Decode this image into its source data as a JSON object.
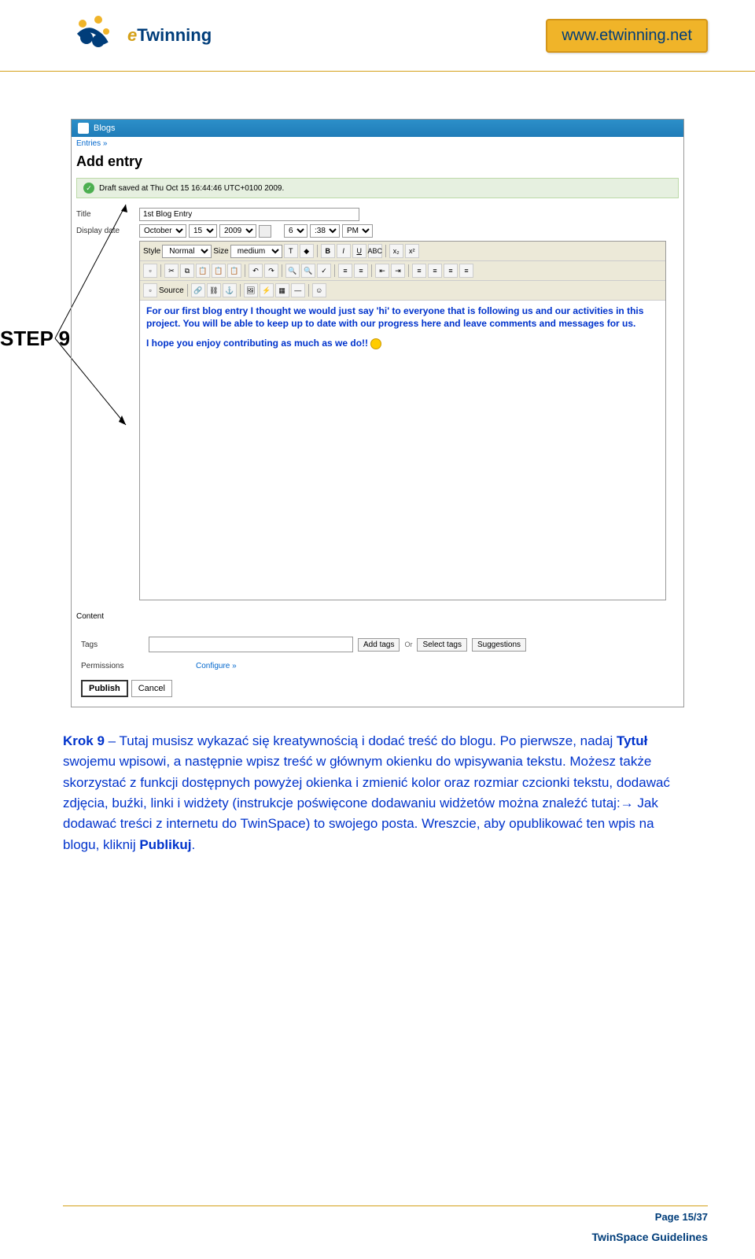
{
  "header": {
    "logo_text_e": "e",
    "logo_text_rest": "Twinning",
    "url": "www.etwinning.net"
  },
  "screenshot": {
    "blogs_label": "Blogs",
    "entries_link": "Entries »",
    "add_entry": "Add entry",
    "draft_saved": "Draft saved at Thu Oct 15 16:44:46 UTC+0100 2009.",
    "title_label": "Title",
    "title_value": "1st Blog Entry",
    "display_date_label": "Display date",
    "date": {
      "month": "October",
      "day": "15",
      "year": "2009",
      "hour": "6",
      "minute": ":38",
      "ampm": "PM"
    },
    "style_label": "Style",
    "style_value": "Normal",
    "size_label": "Size",
    "size_value": "medium",
    "source_label": "Source",
    "content_label": "Content",
    "editor_p1": "For our first blog entry I thought we would just say 'hi' to everyone that is following us and our activities in this project. You will be able to keep up to date with our progress here and leave comments and messages for us.",
    "editor_p2": "I hope you enjoy contributing as much as we do!!",
    "tags_label": "Tags",
    "add_tags": "Add tags",
    "or": "Or",
    "select_tags": "Select tags",
    "suggestions": "Suggestions",
    "permissions_label": "Permissions",
    "configure": "Configure »",
    "publish": "Publish",
    "cancel": "Cancel"
  },
  "step_label": "STEP 9",
  "body": {
    "p1_a": "Krok 9",
    "p1_b": " – Tutaj musisz wykazać się kreatywnością i dodać treść do blogu. Po pierwsze, nadaj ",
    "p1_c": "Tytuł",
    "p1_d": " swojemu wpisowi, a następnie wpisz treść w głównym okienku do wpisywania tekstu. Możesz także skorzystać z funkcji dostępnych powyżej okienka i zmienić kolor oraz rozmiar czcionki tekstu, dodawać zdjęcia, buźki, linki i widżety (instrukcje poświęcone dodawaniu widżetów można znaleźć tutaj:→ Jak dodawać treści z internetu do TwinSpace) to swojego posta. Wreszcie, aby opublikować ten wpis na blogu, kliknij ",
    "p1_e": "Publikuj",
    "p1_f": "."
  },
  "footer": {
    "page": "Page 15/37",
    "guidelines": "TwinSpace Guidelines"
  }
}
